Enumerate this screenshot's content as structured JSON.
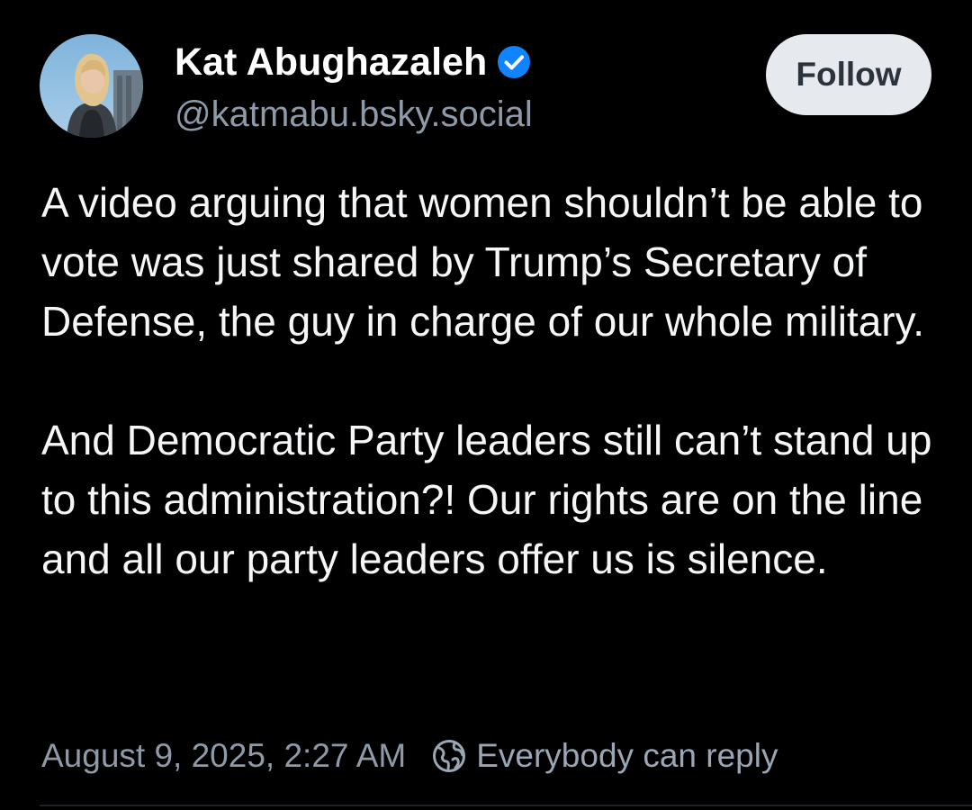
{
  "author": {
    "display_name": "Kat Abughazaleh",
    "handle": "@katmabu.bsky.social",
    "verified_icon": "verified-badge-icon",
    "avatar_icon": "profile-photo"
  },
  "follow_button": {
    "label": "Follow"
  },
  "post": {
    "paragraphs": [
      "A video arguing that women shouldn’t be able to vote was just shared by Trump’s Secretary of Defense, the guy in charge of our whole military.",
      "And Democratic Party leaders still can’t stand up to this administration?! Our rights are on the line and all our party leaders offer us is silence."
    ],
    "timestamp": "August 9, 2025, 2:27 AM",
    "reply_setting": "Everybody can reply",
    "reply_icon": "globe-icon"
  },
  "colors": {
    "background": "#000000",
    "text": "#f5f6f8",
    "muted": "#8e9aa8",
    "verified": "#1083fe",
    "follow_bg": "#e6e9ee",
    "follow_text": "#2b333c"
  }
}
